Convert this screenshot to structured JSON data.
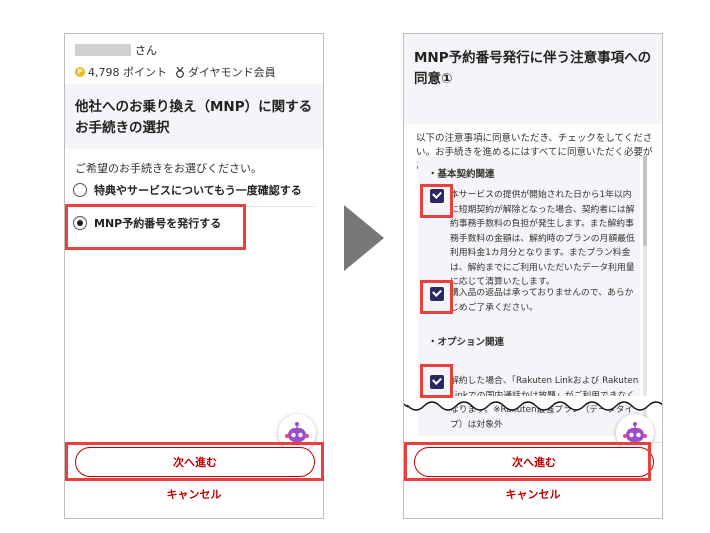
{
  "left": {
    "user": {
      "suffix": "さん"
    },
    "points": {
      "coin_label": "P",
      "amount": "4,798 ポイント",
      "rank": "ダイヤモンド会員"
    },
    "title": "他社へのお乗り換え（MNP）に関するお手続きの選択",
    "prompt": "ご希望のお手続きをお選びください。",
    "options": [
      {
        "label": "特典やサービスについてもう一度確認する",
        "selected": false
      },
      {
        "label": "MNP予約番号を発行する",
        "selected": true
      }
    ],
    "next_label": "次へ進む",
    "cancel_label": "キャンセル"
  },
  "right": {
    "title": "MNP予約番号発行に伴う注意事項への同意①",
    "intro": "以下の注意事項に同意いただき、チェックをしてください。お手続きを進めるにはすべてに同意いただく必要があります。",
    "sections": [
      {
        "heading": "・基本契約関連"
      },
      {
        "heading": "・オプション関連"
      }
    ],
    "items": [
      {
        "text": "本サービスの提供が開始された日から1年以内に短期契約が解除となった場合、契約者には解約事務手数料の負担が発生します。また解約事務手数料の金額は、解約時のプランの月額最低利用料金1カ月分となります。またプラン料金は、解約までにご利用いただいたデータ利用量に応じて清算いたします。",
        "checked": true
      },
      {
        "text": "購入品の返品は承っておりませんので、あらかじめご了承ください。",
        "checked": true
      },
      {
        "text": "解約した場合、「Rakuten Linkおよび Rakuten Linkでの国内通話かけ放題」がご利用できなくなります。※Rakuten最強プラン（データタイプ）は対象外",
        "checked": true
      }
    ],
    "next_label": "次へ進む",
    "cancel_label": "キャンセル"
  },
  "colors": {
    "brand": "#bf0000",
    "highlight": "#e8413c",
    "checkbox": "#2a2a5e",
    "arrow": "#777777"
  },
  "icons": [
    "coin-icon",
    "medal-icon",
    "chatbot-icon",
    "arrow-right-icon",
    "checkbox-icon",
    "radio-icon"
  ]
}
